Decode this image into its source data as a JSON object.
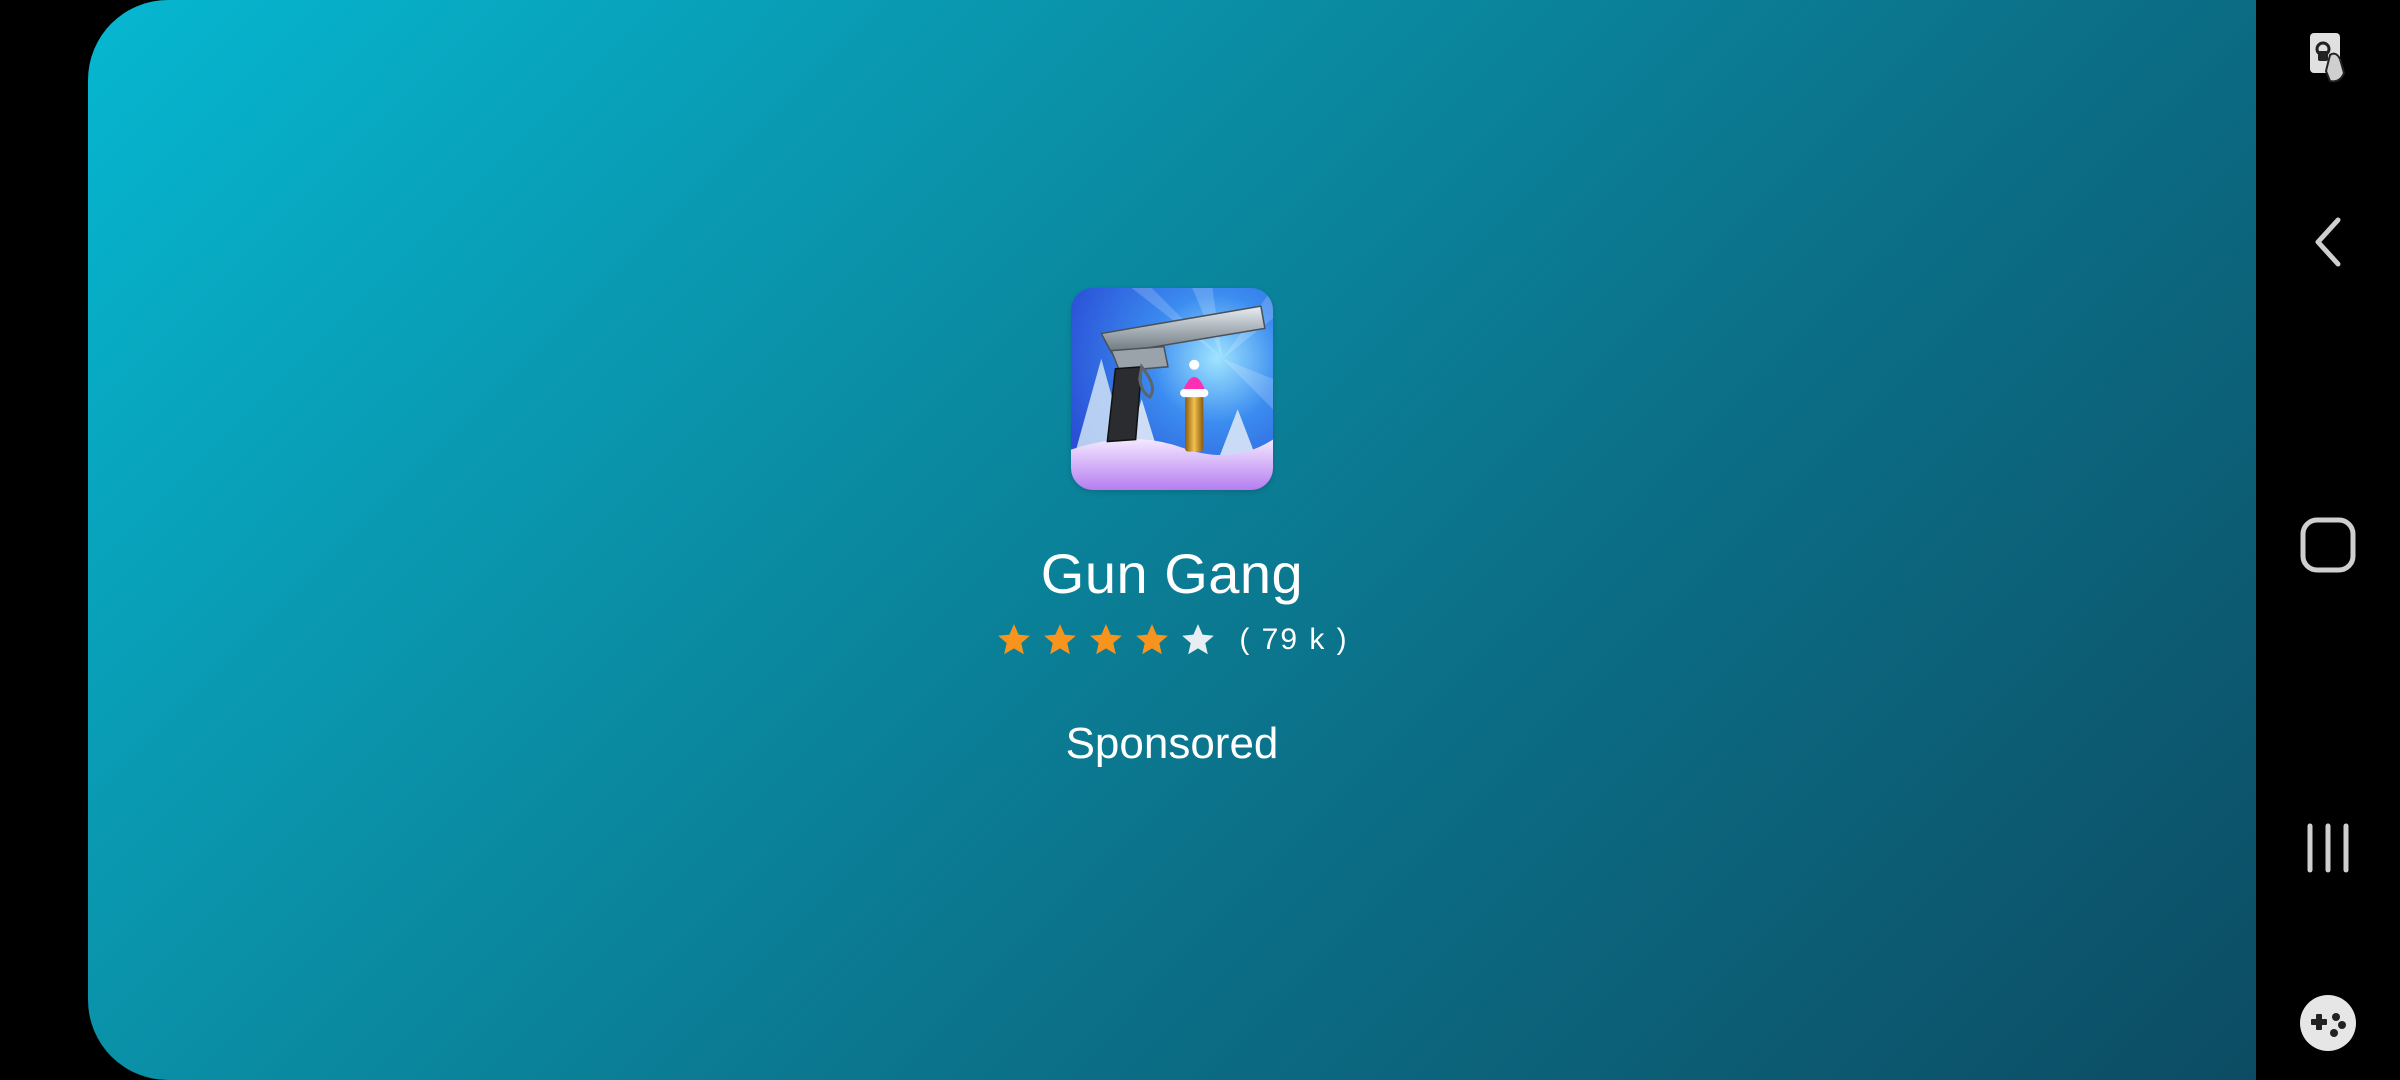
{
  "ad": {
    "app_name": "Gun Gang",
    "rating_stars": 4,
    "rating_max": 5,
    "rating_count": "( 79 k )",
    "sponsored_label": "Sponsored",
    "icon": "gun-gang-app-icon"
  },
  "colors": {
    "gradient_start": "#06b7d1",
    "gradient_end": "#0c4c63",
    "star_filled": "#f7941d",
    "star_empty": "#e6eef2",
    "text": "#ffffff"
  },
  "navbar": {
    "buttons": [
      {
        "icon": "screen-touch-lock-icon"
      },
      {
        "icon": "back-icon"
      },
      {
        "icon": "home-icon"
      },
      {
        "icon": "recents-icon"
      },
      {
        "icon": "game-tools-icon"
      }
    ]
  }
}
